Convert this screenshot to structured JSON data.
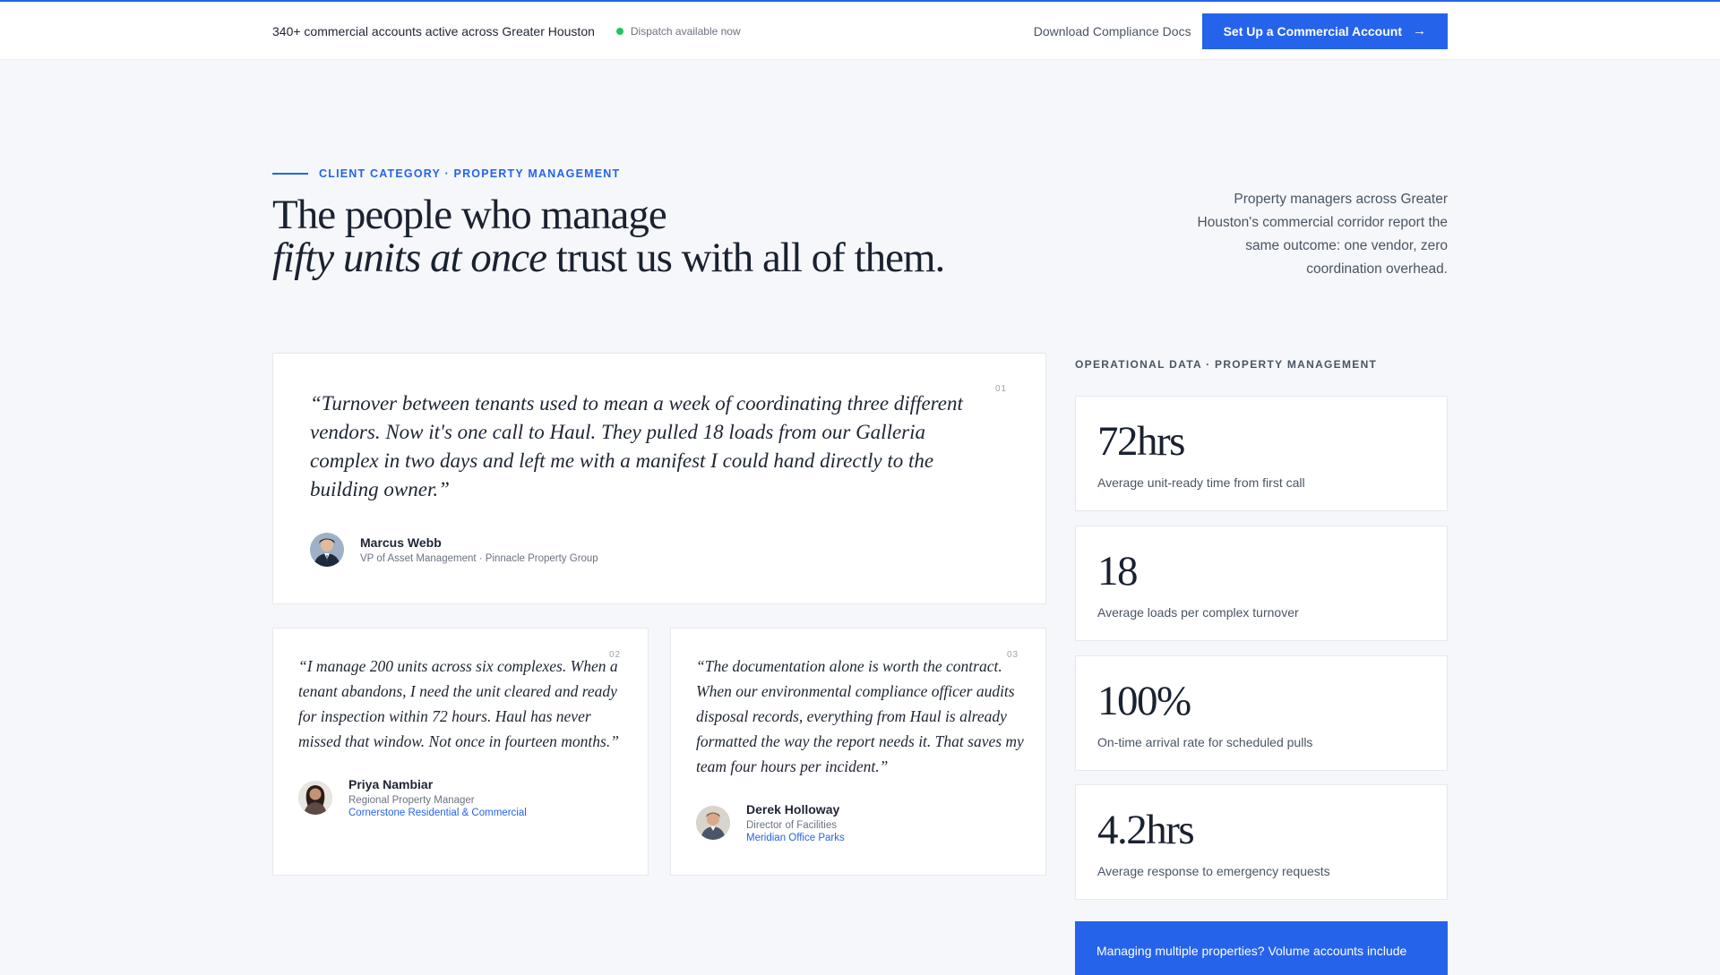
{
  "topbar": {
    "accounts_note": "340+ commercial accounts active across Greater Houston",
    "dispatch_status": "Dispatch available now",
    "docs_link": "Download Compliance Docs",
    "cta_label": "Set Up a Commercial Account",
    "cta_arrow": "→"
  },
  "hero": {
    "eyebrow": "CLIENT CATEGORY · PROPERTY MANAGEMENT",
    "headline_line1": "The people who manage",
    "headline_em": "fifty units at once",
    "headline_rest": " trust us with all of them.",
    "intro": "Property managers across Greater Houston's commercial corridor report the same outcome: one vendor, zero coordination overhead."
  },
  "testimonials": [
    {
      "number": "01",
      "quote": "“Turnover between tenants used to mean a week of coordinating three different vendors. Now it's one call to Haul. They pulled 18 loads from our Galleria complex in two days and left me with a manifest I could hand directly to the building owner.”",
      "name": "Marcus Webb",
      "role": "VP of Asset Management · Pinnacle Property Group",
      "org": ""
    },
    {
      "number": "02",
      "quote": "“I manage 200 units across six complexes. When a tenant abandons, I need the unit cleared and ready for inspection within 72 hours. Haul has never missed that window. Not once in fourteen months.”",
      "name": "Priya Nambiar",
      "role": "Regional Property Manager",
      "org": "Cornerstone Residential & Commercial"
    },
    {
      "number": "03",
      "quote": "“The documentation alone is worth the contract. When our environmental compliance officer audits disposal records, everything from Haul is already formatted the way the report needs it. That saves my team four hours per incident.”",
      "name": "Derek Holloway",
      "role": "Director of Facilities",
      "org": "Meridian Office Parks"
    }
  ],
  "stats": {
    "label": "OPERATIONAL DATA · PROPERTY MANAGEMENT",
    "items": [
      {
        "value": "72hrs",
        "caption": "Average unit-ready time from first call"
      },
      {
        "value": "18",
        "caption": "Average loads per complex turnover"
      },
      {
        "value": "100%",
        "caption": "On-time arrival rate for scheduled pulls"
      },
      {
        "value": "4.2hrs",
        "caption": "Average response to emergency requests"
      }
    ]
  },
  "volume_note": "Managing multiple properties? Volume accounts include",
  "colors": {
    "accent": "#2563eb",
    "status_green": "#22c55e",
    "background": "#f5f7fa",
    "text_dark": "#1a2130"
  }
}
